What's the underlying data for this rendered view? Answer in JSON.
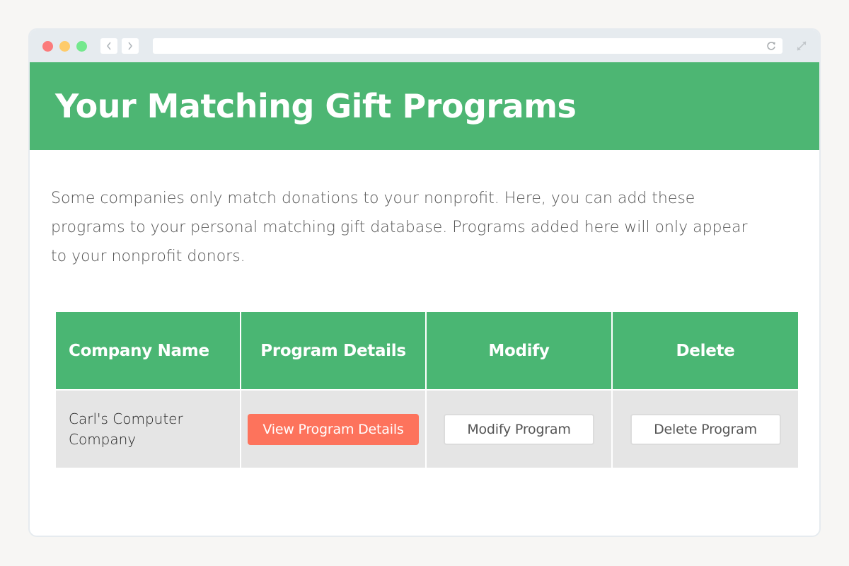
{
  "browser": {
    "back_icon": "chevron-left-icon",
    "forward_icon": "chevron-right-icon",
    "reload_icon": "reload-icon",
    "expand_icon": "expand-icon",
    "url": ""
  },
  "colors": {
    "brand_green": "#4db673",
    "header_green": "#4ab673",
    "action_red": "#fd735c",
    "row_gray": "#e5e5e5"
  },
  "header": {
    "title": "Your Matching Gift Programs"
  },
  "intro": {
    "text": "Some companies only match donations to your nonprofit. Here, you can add these programs to your personal matching gift database. Programs added here will only appear to your nonprofit donors."
  },
  "table": {
    "columns": [
      "Company Name",
      "Program Details",
      "Modify",
      "Delete"
    ],
    "rows": [
      {
        "company": "Carl's Computer Company",
        "details_button": "View Program Details",
        "modify_button": "Modify Program",
        "delete_button": "Delete Program"
      }
    ]
  }
}
